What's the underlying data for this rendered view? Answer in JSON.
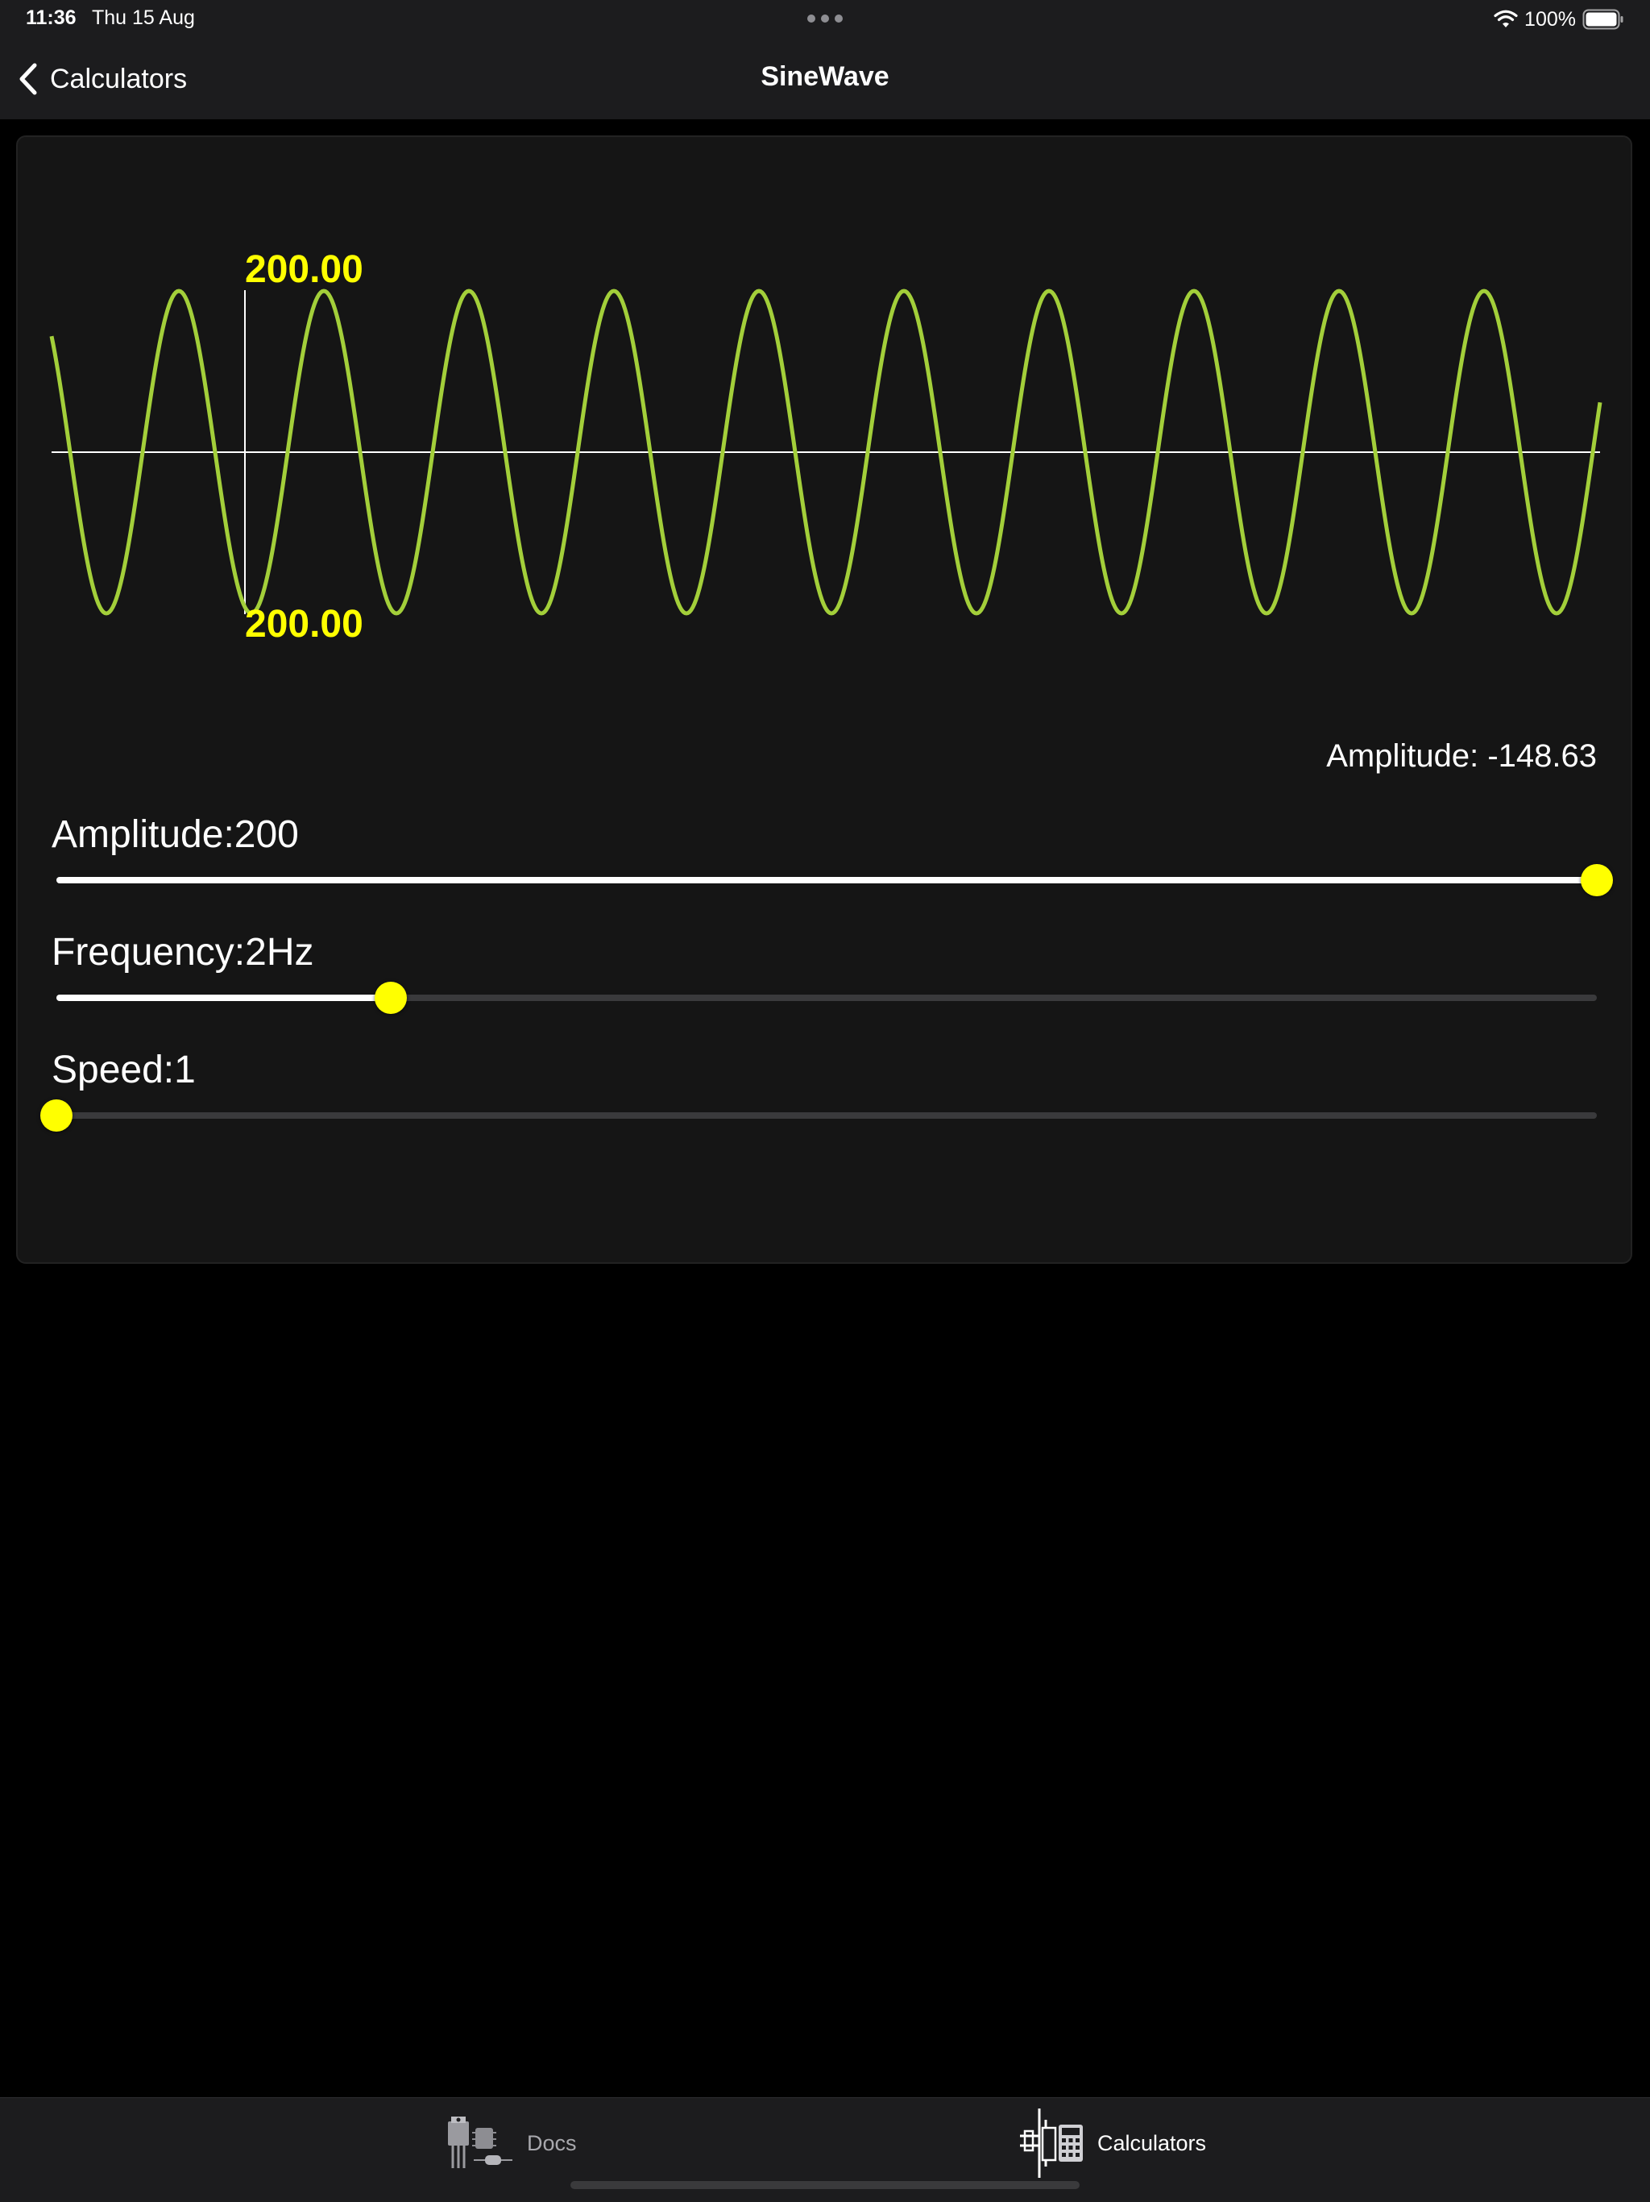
{
  "status_bar": {
    "time": "11:36",
    "date": "Thu 15 Aug",
    "battery": "100%",
    "icons": [
      "wifi-icon",
      "battery-icon",
      "multitasking-dots-icon"
    ]
  },
  "nav": {
    "back_label": "Calculators",
    "title": "SineWave",
    "back_icon": "chevron-left-icon"
  },
  "wave": {
    "top_label": "200.00",
    "bottom_label": "200.00",
    "amplitude": 200,
    "peaks_visible": 11,
    "colors": {
      "wave": "#a3cf3a",
      "value_label": "#ffff00",
      "axis": "#ffffff"
    }
  },
  "readout": {
    "text": "Amplitude: -148.63"
  },
  "sliders": {
    "amplitude": {
      "label": "Amplitude:200",
      "value_fraction": 1.0
    },
    "frequency": {
      "label": "Frequency:2Hz",
      "value_fraction": 0.217
    },
    "speed": {
      "label": "Speed:1",
      "value_fraction": 0.0
    },
    "thumb_color": "#ffff00"
  },
  "tabs": [
    {
      "label": "Docs",
      "icon": "components-icon",
      "selected": false
    },
    {
      "label": "Calculators",
      "icon": "calculator-circuit-icon",
      "selected": true
    }
  ]
}
